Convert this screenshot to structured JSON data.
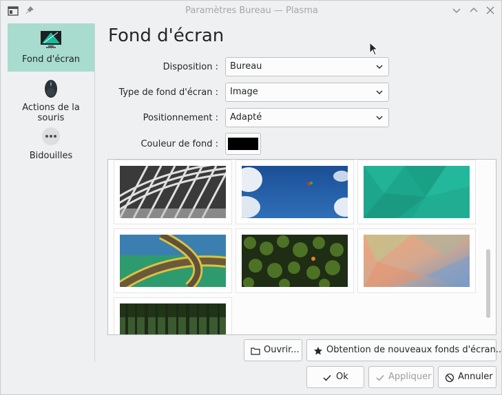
{
  "window": {
    "title": "Paramètres Bureau — Plasma"
  },
  "sidebar": {
    "items": [
      {
        "label": "Fond d'écran",
        "icon": "monitor-wallpaper-icon",
        "active": true
      },
      {
        "label": "Actions de la souris",
        "icon": "mouse-icon",
        "active": false
      },
      {
        "label": "Bidouilles",
        "icon": "more-dots-icon",
        "active": false
      }
    ]
  },
  "page": {
    "title": "Fond d'écran",
    "fields": {
      "disposition": {
        "label": "Disposition :",
        "value": "Bureau"
      },
      "type": {
        "label": "Type de fond d'écran :",
        "value": "Image"
      },
      "position": {
        "label": "Positionnement :",
        "value": "Adapté"
      },
      "color": {
        "label": "Couleur de fond :",
        "value": "#000000"
      }
    }
  },
  "wallpapers": [
    {
      "name": "abstract-architecture",
      "colors": [
        "#2b2b2b",
        "#d9d9d9"
      ]
    },
    {
      "name": "blue-sky-clouds",
      "colors": [
        "#1e4f93",
        "#e8eef7"
      ]
    },
    {
      "name": "teal-polygons",
      "colors": [
        "#1aa38b",
        "#2ab79d"
      ]
    },
    {
      "name": "curvy-road",
      "colors": [
        "#2d9a6a",
        "#6b5a3a"
      ]
    },
    {
      "name": "pine-forest-top",
      "colors": [
        "#1b2a12",
        "#4a6a22"
      ]
    },
    {
      "name": "pastel-polygons",
      "colors": [
        "#e6a47d",
        "#7fa4c2"
      ]
    },
    {
      "name": "forest-trunks",
      "colors": [
        "#2a3b22",
        "#6c8a55"
      ]
    }
  ],
  "buttons": {
    "open": "Ouvrir...",
    "get_new": "Obtention de nouveaux fonds d'écran...",
    "ok": "Ok",
    "apply": "Appliquer",
    "cancel": "Annuler"
  }
}
